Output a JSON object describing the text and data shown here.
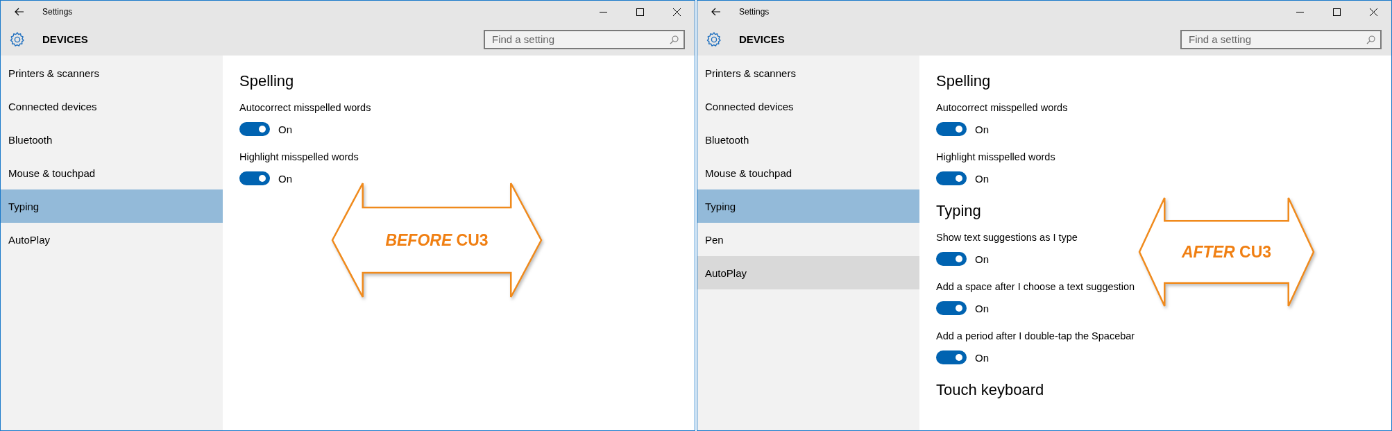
{
  "windows": [
    {
      "title": "Settings",
      "header": "DEVICES",
      "search": {
        "placeholder": "Find a setting"
      },
      "nav": [
        {
          "label": "Printers & scanners",
          "selected": false,
          "hovered": false
        },
        {
          "label": "Connected devices",
          "selected": false,
          "hovered": false
        },
        {
          "label": "Bluetooth",
          "selected": false,
          "hovered": false
        },
        {
          "label": "Mouse & touchpad",
          "selected": false,
          "hovered": false
        },
        {
          "label": "Typing",
          "selected": true,
          "hovered": false
        },
        {
          "label": "AutoPlay",
          "selected": false,
          "hovered": false
        }
      ],
      "sections": [
        {
          "heading": "Spelling",
          "settings": [
            {
              "label": "Autocorrect misspelled words",
              "on": true,
              "state_text": "On"
            },
            {
              "label": "Highlight misspelled words",
              "on": true,
              "state_text": "On"
            }
          ]
        }
      ],
      "callout": {
        "text": "*BEFORE* CU3"
      }
    },
    {
      "title": "Settings",
      "header": "DEVICES",
      "search": {
        "placeholder": "Find a setting"
      },
      "nav": [
        {
          "label": "Printers & scanners",
          "selected": false,
          "hovered": false
        },
        {
          "label": "Connected devices",
          "selected": false,
          "hovered": false
        },
        {
          "label": "Bluetooth",
          "selected": false,
          "hovered": false
        },
        {
          "label": "Mouse & touchpad",
          "selected": false,
          "hovered": false
        },
        {
          "label": "Typing",
          "selected": true,
          "hovered": false
        },
        {
          "label": "Pen",
          "selected": false,
          "hovered": false
        },
        {
          "label": "AutoPlay",
          "selected": false,
          "hovered": true
        }
      ],
      "sections": [
        {
          "heading": "Spelling",
          "settings": [
            {
              "label": "Autocorrect misspelled words",
              "on": true,
              "state_text": "On"
            },
            {
              "label": "Highlight misspelled words",
              "on": true,
              "state_text": "On"
            }
          ]
        },
        {
          "heading": "Typing",
          "settings": [
            {
              "label": "Show text suggestions as I type",
              "on": true,
              "state_text": "On"
            },
            {
              "label": "Add a space after I choose a text suggestion",
              "on": true,
              "state_text": "On"
            },
            {
              "label": "Add a period after I double-tap the Spacebar",
              "on": true,
              "state_text": "On"
            }
          ]
        },
        {
          "heading": "Touch keyboard"
        }
      ],
      "callout": {
        "text": "*AFTER* CU3"
      }
    }
  ]
}
